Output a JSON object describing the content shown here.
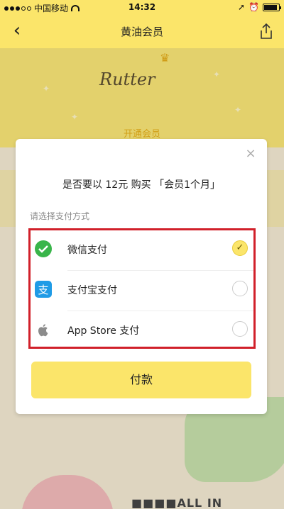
{
  "status_bar": {
    "carrier": "中国移动",
    "time": "14:32",
    "icons": [
      "signal-icon",
      "wifi-icon",
      "location-icon",
      "alarm-icon",
      "battery-icon"
    ]
  },
  "nav": {
    "title": "黄油会员",
    "back_icon": "chevron-left-icon",
    "share_icon": "share-icon"
  },
  "header": {
    "logo_text": "Rutter",
    "open_member_label": "开通会员"
  },
  "modal": {
    "question": "是否要以 12元 购买 「会员1个月」",
    "choose_label": "请选择支付方式",
    "methods": [
      {
        "name": "微信支付",
        "icon": "wechat-pay-icon",
        "checked": true
      },
      {
        "name": "支付宝支付",
        "icon": "alipay-icon",
        "checked": false
      },
      {
        "name": "App Store 支付",
        "icon": "apple-icon",
        "checked": false
      }
    ],
    "pay_button": "付款"
  },
  "colors": {
    "accent": "#fbe56a",
    "highlight_border": "#d1202a",
    "wechat": "#39b54a",
    "alipay": "#1f9be6"
  }
}
